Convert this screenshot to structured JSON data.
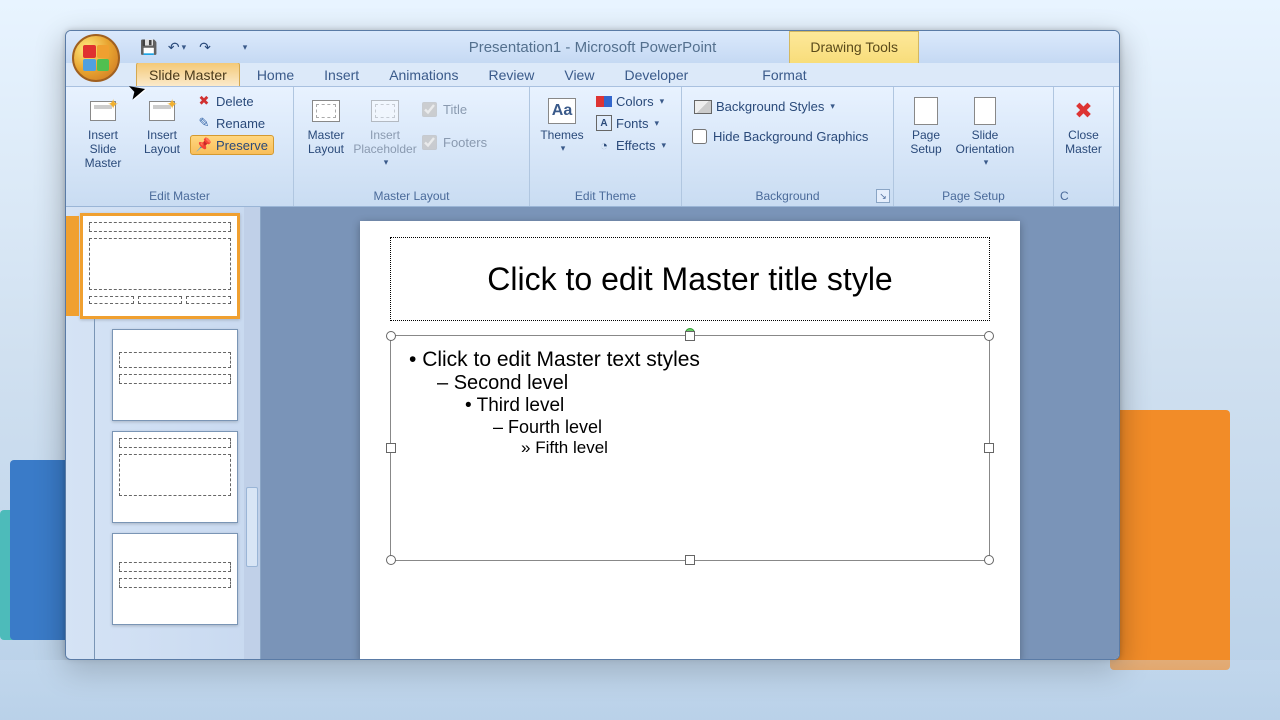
{
  "app": {
    "title": "Presentation1 - Microsoft PowerPoint",
    "contextual_tab": "Drawing Tools"
  },
  "tabs": {
    "slide_master": "Slide Master",
    "home": "Home",
    "insert": "Insert",
    "animations": "Animations",
    "review": "Review",
    "view": "View",
    "developer": "Developer",
    "format": "Format"
  },
  "ribbon": {
    "edit_master": {
      "label": "Edit Master",
      "insert_slide_master": "Insert Slide Master",
      "insert_layout": "Insert Layout",
      "delete": "Delete",
      "rename": "Rename",
      "preserve": "Preserve"
    },
    "master_layout": {
      "label": "Master Layout",
      "master_layout_btn": "Master Layout",
      "insert_placeholder": "Insert Placeholder",
      "title_chk": "Title",
      "footers_chk": "Footers"
    },
    "edit_theme": {
      "label": "Edit Theme",
      "themes": "Themes",
      "colors": "Colors",
      "fonts": "Fonts",
      "effects": "Effects"
    },
    "background": {
      "label": "Background",
      "background_styles": "Background Styles",
      "hide_bg": "Hide Background Graphics"
    },
    "page_setup": {
      "label": "Page Setup",
      "page_setup_btn": "Page Setup",
      "slide_orientation": "Slide Orientation",
      "close_master": "Close Master"
    }
  },
  "slide": {
    "title_placeholder": "Click to edit Master title style",
    "body_levels": {
      "l1": "Click to edit Master text styles",
      "l2": "Second level",
      "l3": "Third level",
      "l4": "Fourth level",
      "l5": "Fifth level"
    }
  }
}
